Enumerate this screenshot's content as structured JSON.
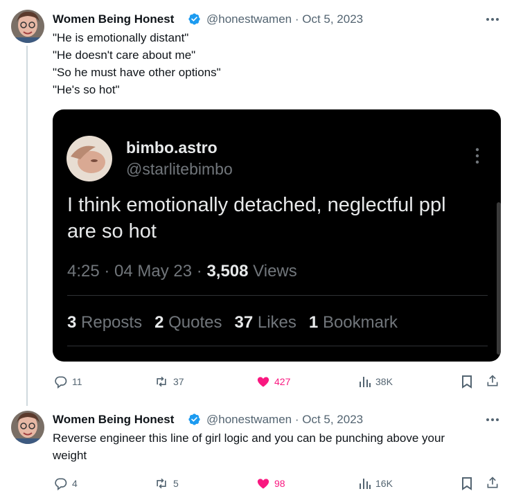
{
  "tweet1": {
    "author_name": "Women Being Honest",
    "handle": "@honestwamen",
    "date": "Oct 5, 2023",
    "lines": [
      "\"He is emotionally distant\"",
      "\"He doesn't care about me\"",
      "\"So he must have other options\"",
      "\"He's so hot\""
    ],
    "quoted": {
      "name": "bimbo.astro",
      "handle": "@starlitebimbo",
      "text_lines": [
        "I think emotionally detached, neglectful ppl",
        "are so hot"
      ],
      "time": "4:25 · 04 May 23 · ",
      "views_count": "3,508",
      "views_label": " Views",
      "stats": [
        {
          "count": "3",
          "label": "Reposts"
        },
        {
          "count": "2",
          "label": "Quotes"
        },
        {
          "count": "37",
          "label": "Likes"
        },
        {
          "count": "1",
          "label": "Bookmark"
        }
      ]
    },
    "actions": {
      "replies": "11",
      "reposts": "37",
      "likes": "427",
      "views": "38K"
    }
  },
  "tweet2": {
    "author_name": "Women Being Honest",
    "handle": "@honestwamen",
    "date": "Oct 5, 2023",
    "lines": [
      "Reverse engineer this line of girl logic and you can be punching above your",
      "weight"
    ],
    "actions": {
      "replies": "4",
      "reposts": "5",
      "likes": "98",
      "views": "16K"
    }
  },
  "colors": {
    "verified": "#1d9bf0",
    "like": "#f91880",
    "secondary": "#536471"
  },
  "separator": " · "
}
